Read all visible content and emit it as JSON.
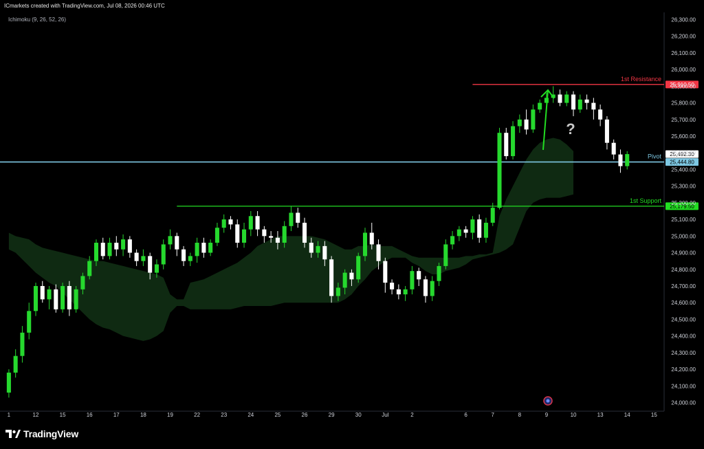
{
  "header": {
    "attribution": "ICmarkets created with TradingView.com, Jul 08, 2026 00:46 UTC",
    "indicator": "Ichimoku (9, 26, 52, 26)"
  },
  "footer": {
    "brand": "TradingView"
  },
  "colors": {
    "background": "#000000",
    "bull": "#26d92e",
    "bear": "#ffffff",
    "resistance": "#f23645",
    "pivot": "#7ec8e3",
    "support": "#22dd22",
    "cloud_bull": "#0f2a12",
    "cloud_bear": "#2a0e10",
    "arrow": "#22dd22"
  },
  "chart_data": {
    "type": "candlestick",
    "instrument_timezone": "UTC",
    "y_axis": {
      "min": 24000,
      "max": 26300,
      "ticks": [
        "26,300.00",
        "26,200.00",
        "26,100.00",
        "26,000.00",
        "25,900.00",
        "25,800.00",
        "25,700.00",
        "25,600.00",
        "25,500.00",
        "25,400.00",
        "25,300.00",
        "25,200.00",
        "25,100.00",
        "25,000.00",
        "24,900.00",
        "24,800.00",
        "24,700.00",
        "24,600.00",
        "24,500.00",
        "24,400.00",
        "24,300.00",
        "24,200.00",
        "24,100.00",
        "24,000.00"
      ]
    },
    "x_axis": {
      "ticks": [
        {
          "label": "1",
          "index": 0
        },
        {
          "label": "12",
          "index": 4
        },
        {
          "label": "15",
          "index": 8
        },
        {
          "label": "16",
          "index": 12
        },
        {
          "label": "17",
          "index": 16
        },
        {
          "label": "18",
          "index": 20
        },
        {
          "label": "19",
          "index": 24
        },
        {
          "label": "22",
          "index": 28
        },
        {
          "label": "23",
          "index": 32
        },
        {
          "label": "24",
          "index": 36
        },
        {
          "label": "25",
          "index": 40
        },
        {
          "label": "26",
          "index": 44
        },
        {
          "label": "29",
          "index": 48
        },
        {
          "label": "30",
          "index": 52
        },
        {
          "label": "Jul",
          "index": 56
        },
        {
          "label": "2",
          "index": 60
        },
        {
          "label": "6",
          "index": 68
        },
        {
          "label": "7",
          "index": 72
        },
        {
          "label": "8",
          "index": 76
        },
        {
          "label": "9",
          "index": 80
        },
        {
          "label": "10",
          "index": 84
        },
        {
          "label": "13",
          "index": 88
        },
        {
          "label": "14",
          "index": 92
        },
        {
          "label": "15",
          "index": 96
        }
      ],
      "total_slots": 98
    },
    "levels": [
      {
        "name": "1st Resistance",
        "value": 25910.5,
        "tag": "25,910.50",
        "kind": "resistance",
        "from_index": 69
      },
      {
        "name": "Pivot",
        "value": 25444.8,
        "tag": "25,444.80",
        "kind": "pivot",
        "from_index": 0
      },
      {
        "name": "1st Support",
        "value": 25179.5,
        "tag": "25,179.50",
        "kind": "support",
        "from_index": 25
      }
    ],
    "last_price": {
      "value": 25492.3,
      "tag": "25,492.30"
    },
    "annotation": {
      "symbol": "?"
    },
    "candles": [
      [
        24060,
        24180,
        24030,
        24200
      ],
      [
        24180,
        24280,
        24150,
        24320
      ],
      [
        24280,
        24420,
        24240,
        24460
      ],
      [
        24420,
        24550,
        24380,
        24600
      ],
      [
        24550,
        24700,
        24520,
        24720
      ],
      [
        24700,
        24620,
        24600,
        24730
      ],
      [
        24620,
        24680,
        24560,
        24700
      ],
      [
        24680,
        24560,
        24540,
        24710
      ],
      [
        24560,
        24700,
        24540,
        24720
      ],
      [
        24700,
        24560,
        24520,
        24730
      ],
      [
        24560,
        24680,
        24540,
        24700
      ],
      [
        24680,
        24760,
        24650,
        24780
      ],
      [
        24760,
        24850,
        24740,
        24880
      ],
      [
        24850,
        24960,
        24820,
        24980
      ],
      [
        24960,
        24880,
        24860,
        24990
      ],
      [
        24880,
        24960,
        24860,
        24990
      ],
      [
        24960,
        24920,
        24880,
        25000
      ],
      [
        24920,
        24980,
        24880,
        25010
      ],
      [
        24980,
        24900,
        24870,
        25000
      ],
      [
        24900,
        24850,
        24820,
        24920
      ],
      [
        24850,
        24880,
        24820,
        24920
      ],
      [
        24880,
        24780,
        24740,
        24900
      ],
      [
        24780,
        24830,
        24750,
        24860
      ],
      [
        24830,
        24950,
        24800,
        24980
      ],
      [
        24950,
        25000,
        24920,
        25040
      ],
      [
        25000,
        24920,
        24880,
        25020
      ],
      [
        24920,
        24850,
        24820,
        24940
      ],
      [
        24850,
        24880,
        24820,
        24900
      ],
      [
        24880,
        24960,
        24840,
        24990
      ],
      [
        24960,
        24900,
        24870,
        24990
      ],
      [
        24900,
        24960,
        24880,
        24980
      ],
      [
        24960,
        25050,
        24940,
        25080
      ],
      [
        25050,
        25100,
        25020,
        25130
      ],
      [
        25100,
        25070,
        25040,
        25120
      ],
      [
        25070,
        24960,
        24930,
        25100
      ],
      [
        24960,
        25040,
        24930,
        25080
      ],
      [
        25040,
        25120,
        25000,
        25150
      ],
      [
        25120,
        25040,
        25000,
        25150
      ],
      [
        25040,
        25000,
        24960,
        25060
      ],
      [
        25000,
        24990,
        24960,
        25030
      ],
      [
        24990,
        24960,
        24920,
        25030
      ],
      [
        24960,
        25060,
        24930,
        25090
      ],
      [
        25060,
        25140,
        25030,
        25180
      ],
      [
        25140,
        25080,
        25050,
        25170
      ],
      [
        25080,
        24960,
        24930,
        25110
      ],
      [
        24960,
        24900,
        24870,
        24990
      ],
      [
        24900,
        24940,
        24870,
        24970
      ],
      [
        24940,
        24860,
        24820,
        24970
      ],
      [
        24860,
        24640,
        24600,
        24880
      ],
      [
        24640,
        24690,
        24610,
        24720
      ],
      [
        24690,
        24780,
        24650,
        24800
      ],
      [
        24780,
        24740,
        24700,
        24800
      ],
      [
        24740,
        24880,
        24720,
        24900
      ],
      [
        24880,
        25020,
        24850,
        25050
      ],
      [
        25020,
        24950,
        24920,
        25080
      ],
      [
        24950,
        24850,
        24800,
        24980
      ],
      [
        24850,
        24720,
        24660,
        24870
      ],
      [
        24720,
        24680,
        24650,
        24740
      ],
      [
        24680,
        24650,
        24620,
        24710
      ],
      [
        24650,
        24680,
        24610,
        24700
      ],
      [
        24680,
        24790,
        24650,
        24820
      ],
      [
        24790,
        24740,
        24700,
        24810
      ],
      [
        24740,
        24640,
        24600,
        24760
      ],
      [
        24640,
        24730,
        24610,
        24760
      ],
      [
        24730,
        24820,
        24700,
        24840
      ],
      [
        24820,
        24950,
        24800,
        24980
      ],
      [
        24950,
        25000,
        24920,
        25030
      ],
      [
        25000,
        25040,
        24970,
        25060
      ],
      [
        25040,
        25020,
        24990,
        25060
      ],
      [
        25020,
        25100,
        24980,
        25120
      ],
      [
        25100,
        24990,
        24960,
        25130
      ],
      [
        24990,
        25080,
        24960,
        25110
      ],
      [
        25080,
        25170,
        25060,
        25200
      ],
      [
        25170,
        25620,
        25160,
        25650
      ],
      [
        25620,
        25480,
        25460,
        25650
      ],
      [
        25480,
        25660,
        25460,
        25690
      ],
      [
        25660,
        25700,
        25620,
        25730
      ],
      [
        25700,
        25640,
        25610,
        25760
      ],
      [
        25640,
        25760,
        25620,
        25790
      ],
      [
        25760,
        25800,
        25740,
        25820
      ],
      [
        25800,
        25830,
        25770,
        25860
      ],
      [
        25830,
        25850,
        25800,
        25900
      ],
      [
        25850,
        25800,
        25780,
        25880
      ],
      [
        25800,
        25850,
        25780,
        25870
      ],
      [
        25850,
        25760,
        25720,
        25870
      ],
      [
        25760,
        25820,
        25740,
        25850
      ],
      [
        25820,
        25800,
        25760,
        25850
      ],
      [
        25800,
        25760,
        25700,
        25830
      ],
      [
        25760,
        25700,
        25660,
        25790
      ],
      [
        25700,
        25560,
        25520,
        25720
      ],
      [
        25560,
        25490,
        25460,
        25580
      ],
      [
        25490,
        25420,
        25380,
        25520
      ],
      [
        25420,
        25492.3,
        25400,
        25510
      ]
    ],
    "cloud": [
      [
        25020,
        24920
      ],
      [
        25000,
        24900
      ],
      [
        24990,
        24860
      ],
      [
        24980,
        24820
      ],
      [
        24950,
        24780
      ],
      [
        24930,
        24750
      ],
      [
        24920,
        24720
      ],
      [
        24910,
        24700
      ],
      [
        24900,
        24660
      ],
      [
        24890,
        24620
      ],
      [
        24880,
        24580
      ],
      [
        24870,
        24540
      ],
      [
        24860,
        24500
      ],
      [
        24850,
        24470
      ],
      [
        24850,
        24450
      ],
      [
        24840,
        24440
      ],
      [
        24830,
        24420
      ],
      [
        24820,
        24400
      ],
      [
        24810,
        24390
      ],
      [
        24800,
        24380
      ],
      [
        24790,
        24370
      ],
      [
        24780,
        24380
      ],
      [
        24770,
        24400
      ],
      [
        24750,
        24430
      ],
      [
        24650,
        24540
      ],
      [
        24620,
        24580
      ],
      [
        24620,
        24580
      ],
      [
        24720,
        24560
      ],
      [
        24730,
        24560
      ],
      [
        24740,
        24560
      ],
      [
        24760,
        24560
      ],
      [
        24780,
        24560
      ],
      [
        24800,
        24560
      ],
      [
        24820,
        24560
      ],
      [
        24840,
        24570
      ],
      [
        24870,
        24580
      ],
      [
        24900,
        24580
      ],
      [
        24940,
        24580
      ],
      [
        24960,
        24580
      ],
      [
        24980,
        24580
      ],
      [
        25000,
        24590
      ],
      [
        25000,
        24600
      ],
      [
        25000,
        24600
      ],
      [
        25000,
        24600
      ],
      [
        25000,
        24600
      ],
      [
        25000,
        24600
      ],
      [
        24990,
        24600
      ],
      [
        24980,
        24600
      ],
      [
        24960,
        24600
      ],
      [
        24940,
        24600
      ],
      [
        24920,
        24620
      ],
      [
        24920,
        24650
      ],
      [
        24940,
        24700
      ],
      [
        24940,
        24740
      ],
      [
        24950,
        24790
      ],
      [
        24940,
        24820
      ],
      [
        24940,
        24850
      ],
      [
        24940,
        24870
      ],
      [
        24920,
        24870
      ],
      [
        24900,
        24870
      ],
      [
        24880,
        24840
      ],
      [
        24870,
        24820
      ],
      [
        24870,
        24790
      ],
      [
        24870,
        24770
      ],
      [
        24870,
        24770
      ],
      [
        24870,
        24790
      ],
      [
        24870,
        24800
      ],
      [
        24870,
        24810
      ],
      [
        24880,
        24830
      ],
      [
        24880,
        24860
      ],
      [
        24890,
        24870
      ],
      [
        24890,
        24880
      ],
      [
        24900,
        24890
      ],
      [
        25120,
        24900
      ],
      [
        25220,
        24920
      ],
      [
        25300,
        24950
      ],
      [
        25380,
        25050
      ],
      [
        25460,
        25150
      ],
      [
        25520,
        25200
      ],
      [
        25560,
        25220
      ],
      [
        25580,
        25230
      ],
      [
        25590,
        25230
      ],
      [
        25580,
        25230
      ],
      [
        25550,
        25240
      ],
      [
        25510,
        25250
      ]
    ]
  }
}
